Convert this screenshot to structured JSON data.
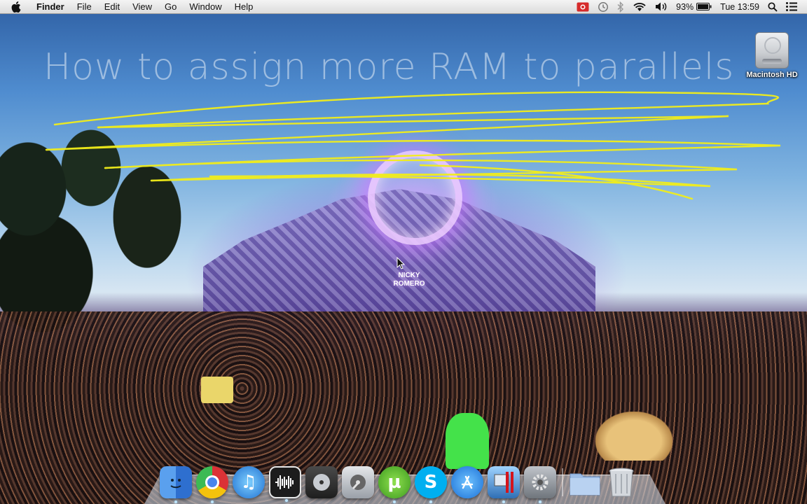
{
  "menubar": {
    "app_name": "Finder",
    "menus": [
      "File",
      "Edit",
      "View",
      "Go",
      "Window",
      "Help"
    ],
    "status": {
      "icons": [
        "screen-record-icon",
        "time-machine-icon",
        "bluetooth-icon",
        "wifi-icon",
        "volume-icon",
        "battery-icon",
        "spotlight-icon",
        "notification-center-icon"
      ],
      "battery_percent": "93%",
      "clock": "Tue 13:59"
    }
  },
  "overlay": {
    "title": "How to assign more RAM to parallels",
    "scribble_color": "#f2ee1a"
  },
  "desktop": {
    "hd_label": "Macintosh HD",
    "stage_logo": "NICKY ROMERO"
  },
  "dock": {
    "items": [
      {
        "name": "finder",
        "icon": "finder-icon",
        "color": "#3e7fd9"
      },
      {
        "name": "chrome",
        "icon": "chrome-icon",
        "color": "#d93025"
      },
      {
        "name": "itunes",
        "icon": "itunes-icon",
        "color": "#2f8fe0"
      },
      {
        "name": "audio-app",
        "icon": "waveform-icon",
        "color": "#1a1a1a"
      },
      {
        "name": "dvd-player",
        "icon": "dvd-player-icon",
        "color": "#6c6c6c"
      },
      {
        "name": "disk-utility",
        "icon": "disk-utility-icon",
        "color": "#9aa0a8"
      },
      {
        "name": "utorrent",
        "icon": "utorrent-icon",
        "color": "#62b32f"
      },
      {
        "name": "skype",
        "icon": "skype-icon",
        "color": "#00aff0"
      },
      {
        "name": "app-store",
        "icon": "app-store-icon",
        "color": "#1e8ae8"
      },
      {
        "name": "parallels",
        "icon": "parallels-icon",
        "color": "#d4141c"
      },
      {
        "name": "system-preferences",
        "icon": "gear-icon",
        "color": "#8a8f96"
      },
      {
        "name": "downloads-folder",
        "icon": "folder-icon",
        "color": "#a9c3e6"
      },
      {
        "name": "trash",
        "icon": "trash-icon",
        "color": "#cfd3d8"
      }
    ]
  }
}
